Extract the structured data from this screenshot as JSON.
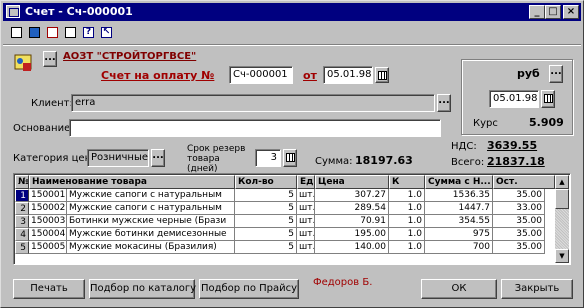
{
  "window": {
    "title": "Счет - Сч-000001",
    "minimize": "_",
    "maximize": "□",
    "close": "×"
  },
  "toolbar": {
    "icons": [
      "print-icon",
      "print-preview-icon",
      "form-icon",
      "copy-icon",
      "help-icon",
      "whats-this-icon"
    ]
  },
  "header": {
    "company": "АОЗТ \"СТРОЙТОРГВСЕ\"",
    "doc_title": "Счет на оплату №",
    "doc_number": "Сч-000001",
    "date_label": "от",
    "date_value": "05.01.98",
    "dots": "..."
  },
  "currency": {
    "name": "руб",
    "date": "05.01.98",
    "rate_label": "Курс",
    "rate_value": "5.909"
  },
  "form": {
    "client_label": "Клиент:",
    "client_value": "erra",
    "basis_label": "Основание:",
    "basis_value": "",
    "price_cat_label": "Категория цен:",
    "price_cat_value": "Розничные",
    "reserve_label": "Срок резерв товара (дней)",
    "reserve_value": "3",
    "sum_label": "Сумма:",
    "sum_value": "18197.63",
    "nds_label": "НДС:",
    "nds_value": "3639.55",
    "total_label": "Всего:",
    "total_value": "21837.18"
  },
  "table": {
    "columns": [
      "№",
      "Наименование товара",
      "Кол-во",
      "Ед",
      "Цена",
      "К",
      "Сумма с Н...",
      "Ост."
    ],
    "rows": [
      [
        "1",
        "150001",
        "Мужские сапоги с натуральным",
        "5",
        "шт.",
        "307.27",
        "1.0",
        "1536.35",
        "35.00"
      ],
      [
        "2",
        "150002",
        "Мужские сапоги с натуральным",
        "5",
        "шт.",
        "289.54",
        "1.0",
        "1447.7",
        "33.00"
      ],
      [
        "3",
        "150003",
        "Ботинки мужские черные (Брази",
        "5",
        "шт.",
        "70.91",
        "1.0",
        "354.55",
        "35.00"
      ],
      [
        "4",
        "150004",
        "Мужские ботинки демисезонные",
        "5",
        "шт.",
        "195.00",
        "1.0",
        "975",
        "35.00"
      ],
      [
        "5",
        "150005",
        "Мужские мокасины (Бразилия)",
        "5",
        "шт.",
        "140.00",
        "1.0",
        "700",
        "35.00"
      ]
    ]
  },
  "footer": {
    "print_btn": "Печать",
    "catalog_btn": "Подбор по каталогу",
    "pricelist_btn": "Подбор по Прайсу",
    "author": "Федоров Б.",
    "ok_btn": "ОК",
    "close_btn": "Закрыть"
  },
  "colors": {
    "title_bg": "#000080",
    "accent_red": "#a00000",
    "face": "#c0c0c0"
  }
}
